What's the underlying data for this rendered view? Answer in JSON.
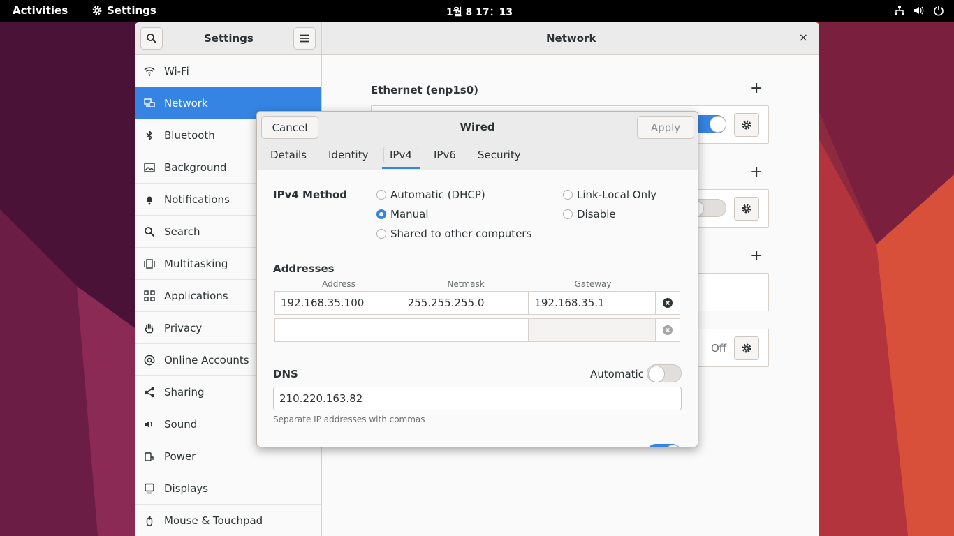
{
  "topbar": {
    "activities": "Activities",
    "app_name": "Settings",
    "clock": "1월 8  17：13"
  },
  "window": {
    "sidebar_title": "Settings",
    "panel_title": "Network",
    "close_glyph": "×"
  },
  "sidebar": {
    "items": [
      {
        "label": "Wi-Fi",
        "icon": "wifi-icon"
      },
      {
        "label": "Network",
        "icon": "network-icon",
        "active": true
      },
      {
        "label": "Bluetooth",
        "icon": "bluetooth-icon"
      },
      {
        "label": "Background",
        "icon": "background-icon"
      },
      {
        "label": "Notifications",
        "icon": "bell-icon"
      },
      {
        "label": "Search",
        "icon": "search-icon"
      },
      {
        "label": "Multitasking",
        "icon": "multitasking-icon"
      },
      {
        "label": "Applications",
        "icon": "apps-grid-icon"
      },
      {
        "label": "Privacy",
        "icon": "hand-icon"
      },
      {
        "label": "Online Accounts",
        "icon": "at-icon"
      },
      {
        "label": "Sharing",
        "icon": "share-icon"
      },
      {
        "label": "Sound",
        "icon": "speaker-icon"
      },
      {
        "label": "Power",
        "icon": "power-plug-icon"
      },
      {
        "label": "Displays",
        "icon": "display-icon"
      },
      {
        "label": "Mouse & Touchpad",
        "icon": "mouse-icon"
      }
    ]
  },
  "network_panel": {
    "ethernet_title": "Ethernet (enp1s0)",
    "off_label": "Off"
  },
  "dialog": {
    "title": "Wired",
    "cancel": "Cancel",
    "apply": "Apply",
    "tabs": [
      "Details",
      "Identity",
      "IPv4",
      "IPv6",
      "Security"
    ],
    "active_tab": "IPv4",
    "ipv4_method_label": "IPv4 Method",
    "methods": {
      "automatic": "Automatic (DHCP)",
      "link_local": "Link-Local Only",
      "manual": "Manual",
      "disable": "Disable",
      "shared": "Shared to other computers"
    },
    "selected_method": "Manual",
    "addresses_label": "Addresses",
    "columns": [
      "Address",
      "Netmask",
      "Gateway"
    ],
    "rows": [
      {
        "address": "192.168.35.100",
        "netmask": "255.255.255.0",
        "gateway": "192.168.35.1"
      },
      {
        "address": "",
        "netmask": "",
        "gateway": ""
      }
    ],
    "dns_label": "DNS",
    "automatic_label": "Automatic",
    "dns_automatic": false,
    "dns_value": "210.220.163.82",
    "dns_hint": "Separate IP addresses with commas"
  },
  "colors": {
    "accent": "#3584e4",
    "topbar": "#000000",
    "headerbar": "#ebebeb"
  }
}
